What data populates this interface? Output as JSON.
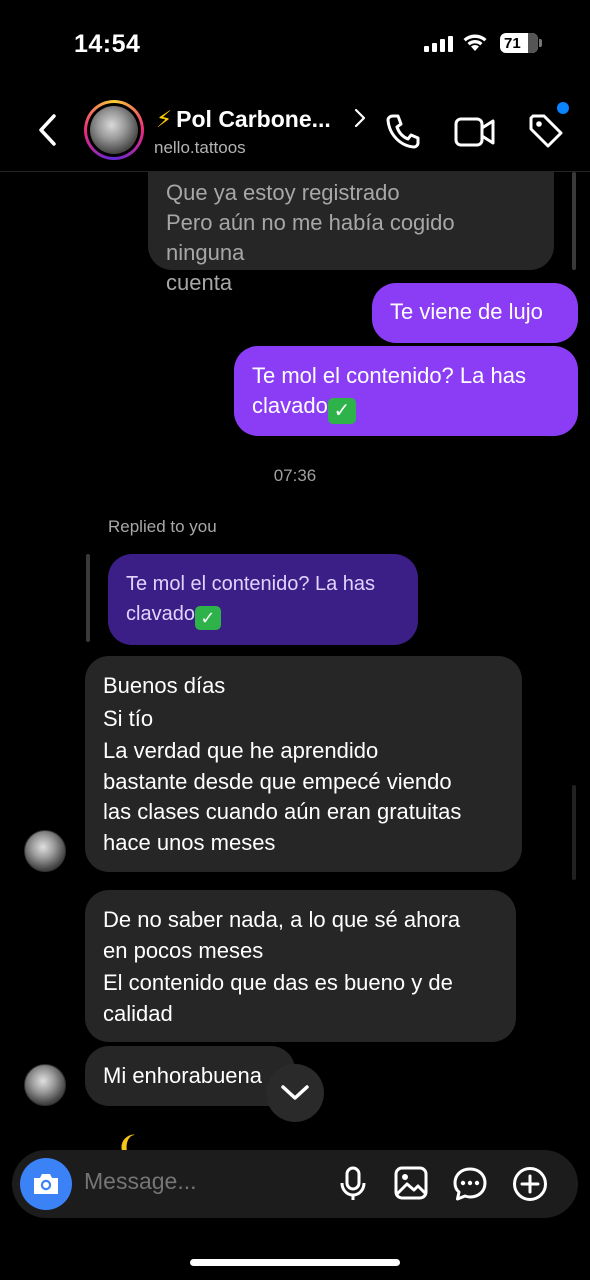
{
  "status": {
    "time": "14:54",
    "battery": "71"
  },
  "header": {
    "name": "Pol Carbone...",
    "username": "nello.tattoos"
  },
  "messages": {
    "top_incoming": [
      "Que ya estoy registrado",
      "Pero aún no me había cogido ninguna",
      "cuenta"
    ],
    "out1": "Te viene de lujo",
    "out2_line1": "Te mol el contenido? La has",
    "out2_line2": "clavado",
    "time": "07:36",
    "replied_label": "Replied to you",
    "reply_line1": "Te mol el contenido? La has",
    "reply_line2": "clavado",
    "in1": [
      "Buenos días",
      "Si tío",
      "La verdad que he aprendido",
      "bastante desde que empecé viendo",
      "las clases cuando aún eran gratuitas",
      "hace unos meses"
    ],
    "in2": [
      "De no saber nada, a lo que sé ahora",
      "en pocos meses",
      "El contenido que das es bueno y de",
      "calidad"
    ],
    "in3": "Mi enhorabuena"
  },
  "composer": {
    "placeholder": "Message..."
  },
  "colors": {
    "outgoing": "#8b3df6",
    "incoming": "#262626",
    "reply": "#3c1f86",
    "camera": "#3a82f6"
  }
}
